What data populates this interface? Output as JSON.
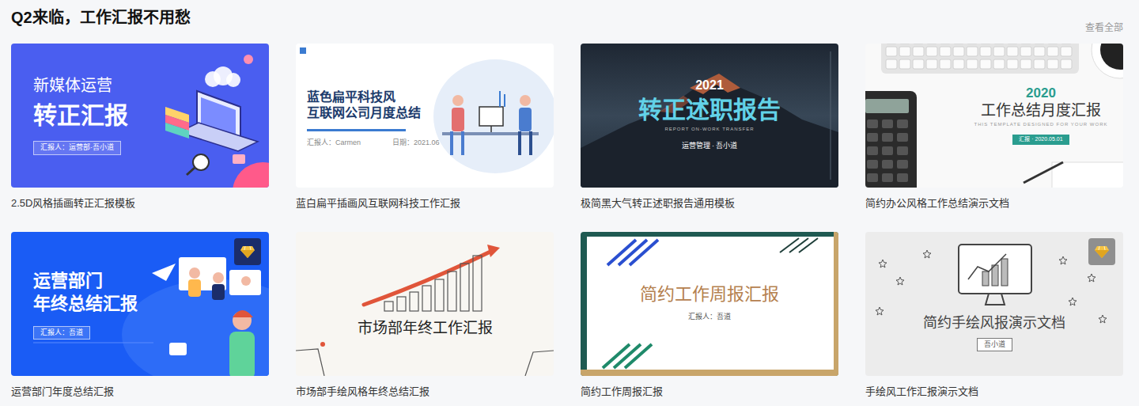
{
  "section": {
    "title": "Q2来临，工作汇报不用愁",
    "more": "查看全部"
  },
  "cards": [
    {
      "caption": "2.5D风格插画转正汇报模板",
      "premium": false,
      "thumb": {
        "kind": "iso-left",
        "color": "#4a5ef0",
        "lines": [
          {
            "kind": "sub",
            "text": "新媒体运营"
          },
          {
            "kind": "title-lg",
            "text": "转正汇报"
          },
          {
            "kind": "pill",
            "text": "汇报人：运营部·吾小道"
          }
        ]
      }
    },
    {
      "caption": "蓝白扁平插画风互联网科技工作汇报",
      "premium": false,
      "thumb": {
        "kind": "flat-left",
        "color": "#ffffff",
        "lines": [
          {
            "kind": "title",
            "text": "蓝色扁平科技风"
          },
          {
            "kind": "title",
            "text": "互联网公司月度总结"
          },
          {
            "kind": "meta",
            "text": "汇报人：Carmen"
          },
          {
            "kind": "meta",
            "text": "日期：2021.06"
          }
        ]
      }
    },
    {
      "caption": "极简黑大气转正述职报告通用模板",
      "premium": false,
      "thumb": {
        "kind": "dark-center",
        "color": "#26323f",
        "lines": [
          {
            "kind": "year",
            "text": "2021"
          },
          {
            "kind": "title-lg",
            "text": "转正述职报告"
          },
          {
            "kind": "caps",
            "text": "REPORT ON-WORK TRANSFER"
          },
          {
            "kind": "meta",
            "text": "运营管理 · 吾小道"
          }
        ]
      }
    },
    {
      "caption": "简约办公风格工作总结演示文档",
      "premium": false,
      "thumb": {
        "kind": "desk-right",
        "color": "#f9f9f9",
        "lines": [
          {
            "kind": "year",
            "text": "2020"
          },
          {
            "kind": "title",
            "text": "工作总结月度汇报"
          },
          {
            "kind": "caps",
            "text": "THIS TEMPLATE DESIGNED FOR YOUR WORK"
          },
          {
            "kind": "pill",
            "text": "汇报 · 2020.05.01"
          }
        ]
      }
    },
    {
      "caption": "运营部门年度总结汇报",
      "premium": true,
      "thumb": {
        "kind": "team-left",
        "color": "#1a5cf5",
        "lines": [
          {
            "kind": "title",
            "text": "运营部门"
          },
          {
            "kind": "title",
            "text": "年终总结汇报"
          },
          {
            "kind": "pill",
            "text": "汇报人：吾道"
          }
        ]
      }
    },
    {
      "caption": "市场部手绘风格年终总结汇报",
      "premium": false,
      "thumb": {
        "kind": "paper-center",
        "color": "#f8f6f2",
        "lines": [
          {
            "kind": "title",
            "text": "市场部年终工作汇报"
          }
        ]
      }
    },
    {
      "caption": "简约工作周报汇报",
      "premium": false,
      "thumb": {
        "kind": "frame-center",
        "color": "#ffffff",
        "lines": [
          {
            "kind": "title",
            "text": "简约工作周报汇报"
          },
          {
            "kind": "meta",
            "text": "汇报人：吾道"
          }
        ]
      }
    },
    {
      "caption": "手绘风工作汇报演示文档",
      "premium": true,
      "thumb": {
        "kind": "sketch-center",
        "color": "#ececec",
        "lines": [
          {
            "kind": "title",
            "text": "简约手绘风报演示文档"
          },
          {
            "kind": "pill",
            "text": "吾小道"
          }
        ]
      }
    }
  ]
}
